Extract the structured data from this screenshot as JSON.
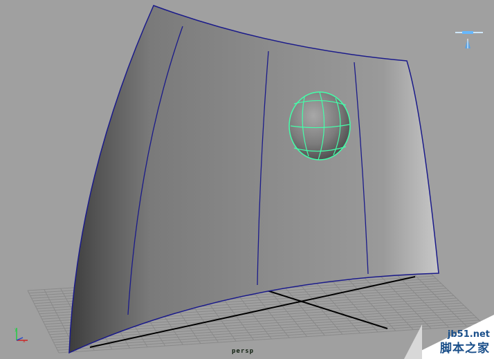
{
  "viewport": {
    "camera": "persp",
    "background_color": "#a0a0a0",
    "wireframe_color": "#1a1a8a",
    "selection_color": "#44ffaa"
  },
  "scene": {
    "objects": [
      {
        "name": "curved-nurbs-wall",
        "selected": false
      },
      {
        "name": "nurbs-sphere",
        "selected": true
      }
    ],
    "grid": true
  },
  "hud": {
    "axis_icon": "axis-triad-icon",
    "view_cube_icon": "view-compass-icon"
  },
  "watermark": {
    "site": "jb51.net",
    "name": "脚本之家"
  }
}
